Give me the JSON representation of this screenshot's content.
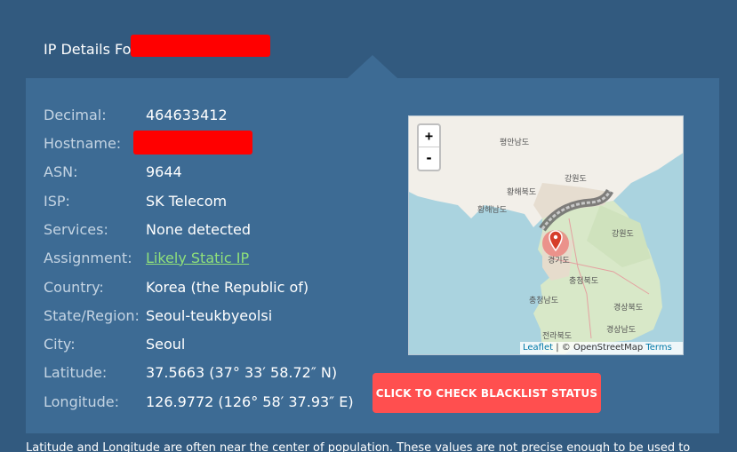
{
  "header": {
    "title": "IP Details Fo"
  },
  "details": [
    {
      "label": "Decimal:",
      "value": "464633412"
    },
    {
      "label": "Hostname:",
      "value": ""
    },
    {
      "label": "ASN:",
      "value": "9644"
    },
    {
      "label": "ISP:",
      "value": "SK Telecom"
    },
    {
      "label": "Services:",
      "value": "None detected"
    },
    {
      "label": "Assignment:",
      "value": "Likely Static IP"
    },
    {
      "label": "Country:",
      "value": "Korea (the Republic of)"
    },
    {
      "label": "State/Region:",
      "value": "Seoul-teukbyeolsi"
    },
    {
      "label": "City:",
      "value": "Seoul"
    },
    {
      "label": "Latitude:",
      "value": "37.5663  (37° 33′ 58.72″ N)"
    },
    {
      "label": "Longitude:",
      "value": "126.9772  (126° 58′ 37.93″ E)"
    }
  ],
  "map": {
    "zoom_in": "+",
    "zoom_out": "-",
    "attrib_leaflet": "Leaflet",
    "attrib_sep": " | © OpenStreetMap ",
    "attrib_terms": "Terms",
    "places": [
      "평안남도",
      "강원도",
      "황해북도",
      "황해남도",
      "경기도",
      "강원도",
      "충청북도",
      "충청남도",
      "경상북도",
      "경상남도",
      "전라북도"
    ]
  },
  "blacklist_button": "CLICK TO CHECK BLACKLIST STATUS",
  "note": "Latitude and Longitude are often near the center of population. These values are not precise enough to be used to",
  "colors": {
    "background": "#325a7f",
    "panel": "#3d6b94",
    "button": "#ff4f4f",
    "link": "#8fe07a",
    "redaction": "#ff0000"
  }
}
